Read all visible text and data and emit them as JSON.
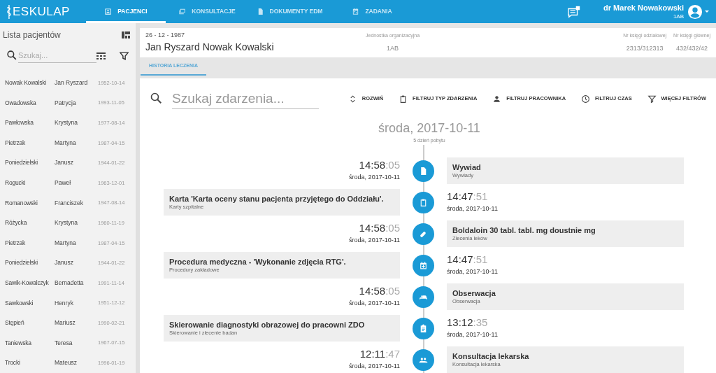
{
  "app": {
    "logo": "ESKULAP",
    "nav": [
      {
        "label": "PACJENCI",
        "kind": "patients",
        "selected": true
      },
      {
        "label": "KONSULTACJE",
        "kind": "consultations",
        "selected": false
      },
      {
        "label": "DOKUMENTY EDM",
        "kind": "documents",
        "selected": false
      },
      {
        "label": "ZADANIA",
        "kind": "tasks",
        "selected": false
      }
    ],
    "user": {
      "name": "dr Marek Nowakowski",
      "unit": "1AB"
    }
  },
  "sidebar": {
    "title": "Lista pacjentów",
    "search": {
      "placeholder": "Szukaj..."
    },
    "patients": [
      {
        "surname": "Nowak Kowalski",
        "first_name": "Jan Ryszard",
        "birth_date": "1952-10-14"
      },
      {
        "surname": "Owadowska",
        "first_name": "Patrycja",
        "birth_date": "1993-11-05"
      },
      {
        "surname": "Pawłowska",
        "first_name": "Krystyna",
        "birth_date": "1977-08-14"
      },
      {
        "surname": "Pietrzak",
        "first_name": "Martyna",
        "birth_date": "1987-04-15"
      },
      {
        "surname": "Poniedzielski",
        "first_name": "Janusz",
        "birth_date": "1944-01-22"
      },
      {
        "surname": "Rogucki",
        "first_name": "Paweł",
        "birth_date": "1963-12-01"
      },
      {
        "surname": "Romanowski",
        "first_name": "Franciszek",
        "birth_date": "1947-08-14"
      },
      {
        "surname": "Różycka",
        "first_name": "Krystyna",
        "birth_date": "1960-11-19"
      },
      {
        "surname": "Pietrzak",
        "first_name": "Martyna",
        "birth_date": "1987-04-15"
      },
      {
        "surname": "Poniedzielski",
        "first_name": "Janusz",
        "birth_date": "1944-01-22"
      },
      {
        "surname": "Sawik-Kowalczyk",
        "first_name": "Bernadetta",
        "birth_date": "1991-11-14"
      },
      {
        "surname": "Sawkowski",
        "first_name": "Henryk",
        "birth_date": "1951-12-12"
      },
      {
        "surname": "Stępień",
        "first_name": "Mariusz",
        "birth_date": "1990-02-21"
      },
      {
        "surname": "Taniewska",
        "first_name": "Teresa",
        "birth_date": "1967-07-15"
      },
      {
        "surname": "Trocki",
        "first_name": "Mateusz",
        "birth_date": "1996-01-19"
      }
    ]
  },
  "patient_header": {
    "birth_date": "26 - 12 - 1987",
    "name": "Jan Ryszard Nowak Kowalski",
    "fields": [
      {
        "label": "Jednostka organizacyjna",
        "value": "1AB"
      },
      {
        "label": "Nr księgi odziałowej",
        "value": "2313/312313"
      },
      {
        "label": "Nr księgi głównej",
        "value": "432/432/42"
      }
    ]
  },
  "tabs": [
    {
      "label": "HISTORIA LECZENIA",
      "selected": true
    }
  ],
  "toolbar": {
    "search": {
      "placeholder": "Szukaj zdarzenia..."
    },
    "buttons": [
      {
        "label": "ROZWIŃ",
        "kind": "expand"
      },
      {
        "label": "FILTRUJ TYP ZDARZENIA",
        "kind": "type"
      },
      {
        "label": "FILTRUJ PRACOWNIKA",
        "kind": "employee"
      },
      {
        "label": "FILTRUJ CZAS",
        "kind": "time"
      },
      {
        "label": "WIĘCEJ FILTRÓW",
        "kind": "more"
      }
    ]
  },
  "timeline": {
    "day": "środa, 2017-10-11",
    "stay_day": "5 dzień pobytu",
    "events": [
      {
        "kind": "interview",
        "time": "14:58",
        "seconds": ":05",
        "date": "środa, 2017-10-11",
        "title": "Wywiad",
        "category": "Wywiady"
      },
      {
        "kind": "form",
        "time": "14:47",
        "seconds": ":51",
        "date": "środa, 2017-10-11",
        "title": "Karta 'Karta oceny stanu pacjenta przyjętego do Oddziału'.",
        "category": "Karty szpitalne"
      },
      {
        "kind": "medication",
        "time": "14:58",
        "seconds": ":05",
        "date": "środa, 2017-10-11",
        "title": "Boldaloin 30 tabl. tabl. mg doustnie mg",
        "category": "Zlecenia leków"
      },
      {
        "kind": "procedure",
        "time": "14:47",
        "seconds": ":51",
        "date": "środa, 2017-10-11",
        "title": "Procedura medyczna - 'Wykonanie zdjęcia RTG'.",
        "category": "Procedury zakładowe"
      },
      {
        "kind": "observation",
        "time": "14:58",
        "seconds": ":05",
        "date": "środa, 2017-10-11",
        "title": "Obserwacja",
        "category": "Obserwacja"
      },
      {
        "kind": "referral",
        "time": "13:12",
        "seconds": ":35",
        "date": "środa, 2017-10-11",
        "title": "Skierowanie diagnostyki obrazowej do pracowni ZDO",
        "category": "Skierowanie i zlecenie badan"
      },
      {
        "kind": "consultation",
        "time": "12:11",
        "seconds": ":47",
        "date": "środa, 2017-10-11",
        "title": "Konsultacja lekarska",
        "category": "Konsultacja lekarska"
      }
    ]
  }
}
